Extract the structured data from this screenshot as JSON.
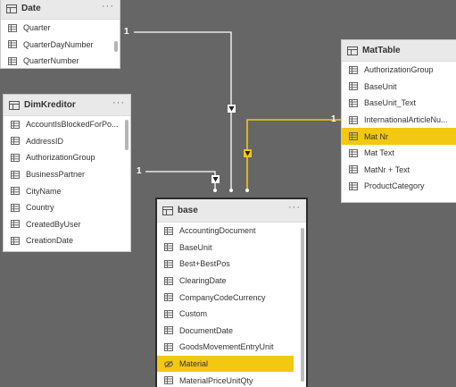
{
  "tables": {
    "date": {
      "title": "Date",
      "fields": [
        "Quarter",
        "QuarterDayNumber",
        "QuarterNumber"
      ]
    },
    "dimkreditor": {
      "title": "DimKreditor",
      "fields": [
        "AccountIsBlockedForPo...",
        "AddressID",
        "AuthorizationGroup",
        "BusinessPartner",
        "CityName",
        "Country",
        "CreatedByUser",
        "CreationDate"
      ]
    },
    "mattable": {
      "title": "MatTable",
      "fields": [
        "AuthorizationGroup",
        "BaseUnit",
        "BaseUnit_Text",
        "InternationalArticleNu...",
        "Mat Nr",
        "Mat Text",
        "MatNr + Text",
        "ProductCategory"
      ],
      "highlighted": "Mat Nr"
    },
    "base": {
      "title": "base",
      "fields": [
        "AccountingDocument",
        "BaseUnit",
        "Best+BestPos",
        "ClearingDate",
        "CompanyCodeCurrency",
        "Custom",
        "DocumentDate",
        "GoodsMovementEntryUnit",
        "Material",
        "MaterialPriceUnitQty"
      ],
      "highlighted": "Material"
    }
  },
  "relationships": {
    "date_base": "1",
    "dimkreditor_base": "1",
    "mattable_base": "1"
  },
  "colors": {
    "canvas": "#666666",
    "highlight": "#f2c811",
    "line": "#ffffff"
  },
  "more_icon": "ellipsis-icon"
}
